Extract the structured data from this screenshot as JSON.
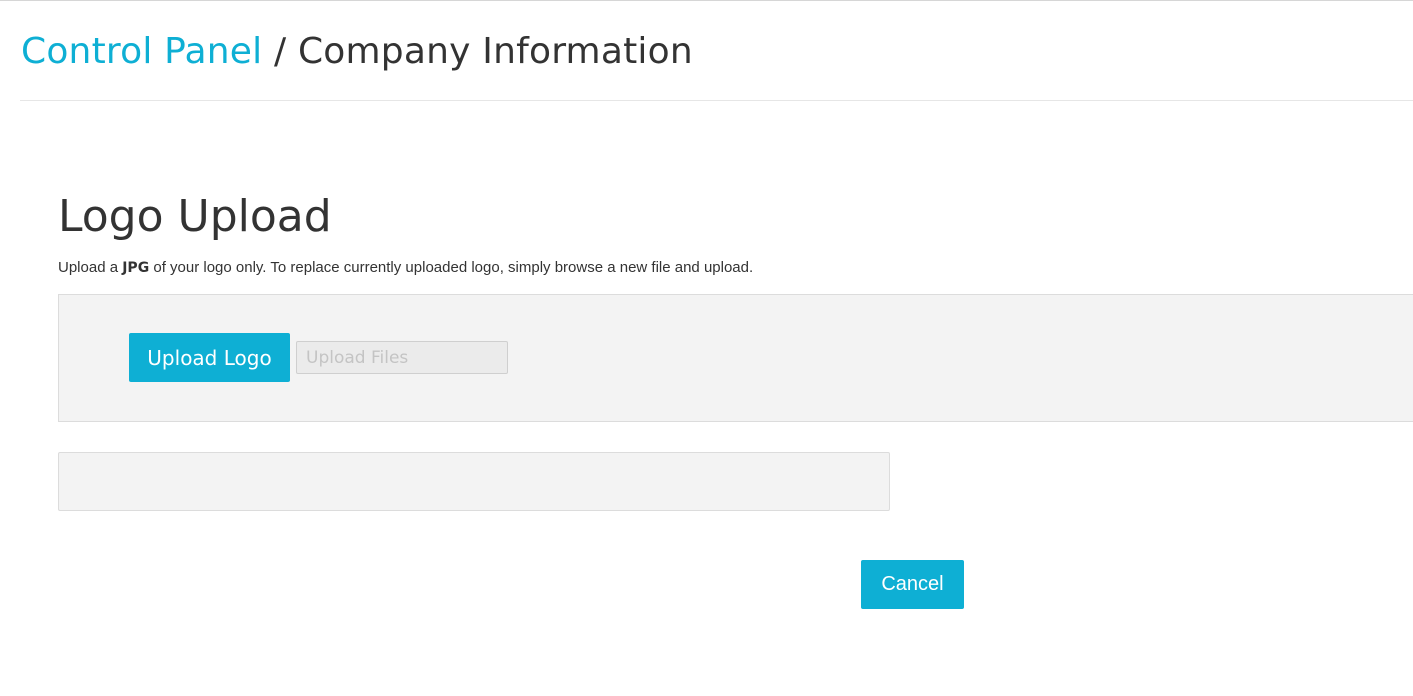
{
  "colors": {
    "accent": "#0eafd4",
    "text": "#333333",
    "panel_background": "#f3f3f3"
  },
  "breadcrumb": {
    "parent_label": "Control Panel",
    "separator": "/",
    "current_label": "Company Information"
  },
  "logo_upload": {
    "title": "Logo Upload",
    "instructions_prefix": "Upload a ",
    "instructions_format": "JPG",
    "instructions_suffix": " of your logo only. To replace currently uploaded logo, simply browse a new file and upload.",
    "upload_button_label": "Upload Logo",
    "file_field_value": "",
    "file_field_placeholder": "Upload Files"
  },
  "actions": {
    "cancel_label": "Cancel"
  }
}
